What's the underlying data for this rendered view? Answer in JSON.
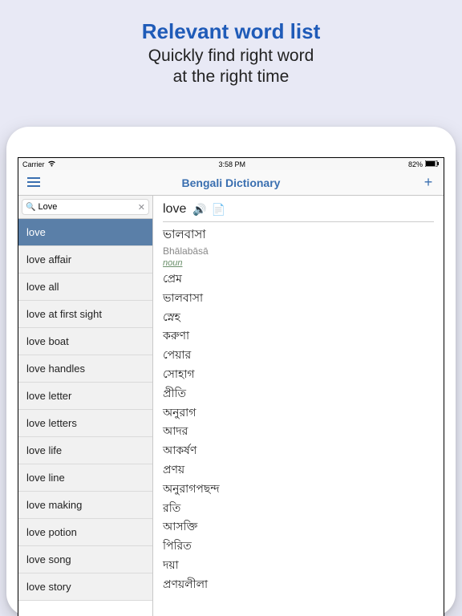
{
  "promo": {
    "title": "Relevant word list",
    "line1": "Quickly find right word",
    "line2": "at the right time"
  },
  "status": {
    "carrier": "Carrier",
    "time": "3:58 PM",
    "battery": "82%"
  },
  "nav": {
    "title": "Bengali Dictionary"
  },
  "search": {
    "query": "Love"
  },
  "sidebar": {
    "items": [
      {
        "label": "love",
        "selected": true
      },
      {
        "label": "love affair"
      },
      {
        "label": "love all"
      },
      {
        "label": "love at first sight"
      },
      {
        "label": "love boat"
      },
      {
        "label": "love handles"
      },
      {
        "label": "love letter"
      },
      {
        "label": "love letters"
      },
      {
        "label": "love life"
      },
      {
        "label": "love line"
      },
      {
        "label": "love making"
      },
      {
        "label": "love potion"
      },
      {
        "label": "love song"
      },
      {
        "label": "love story"
      }
    ]
  },
  "detail": {
    "word": "love",
    "script": "ভালবাসা",
    "roman": "Bhālabāsā",
    "pos": "noun",
    "meanings": [
      "প্রেম",
      "ভালবাসা",
      "স্নেহ",
      "করুণা",
      "পেয়ার",
      "সোহাগ",
      "প্রীতি",
      "অনুরাগ",
      "আদর",
      "আকর্ষণ",
      "প্রণয়",
      "অনুরাগপছন্দ",
      "রতি",
      "আসক্তি",
      "পিরিত",
      "দয়া",
      "প্রণয়লীলা"
    ]
  }
}
